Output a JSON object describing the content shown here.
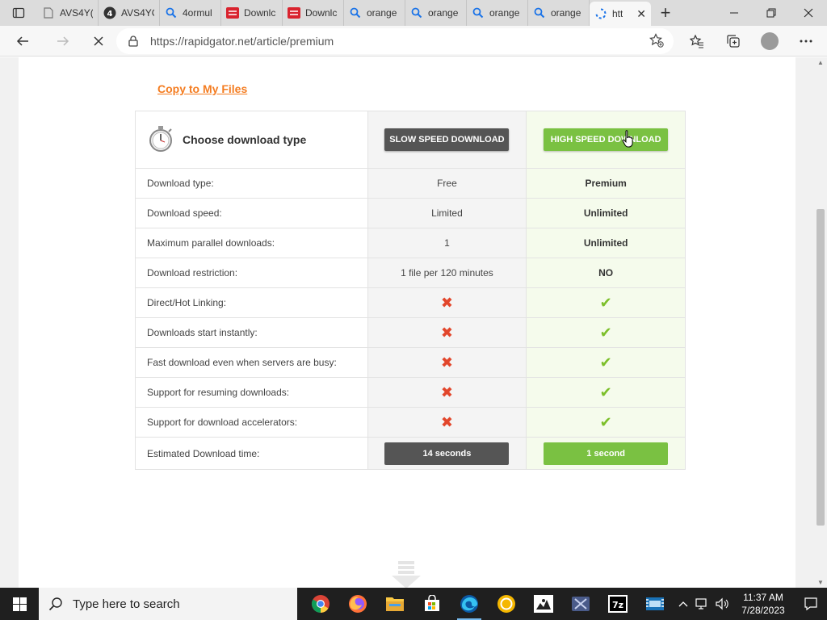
{
  "browser": {
    "tabs": [
      {
        "label": "AVS4Y(",
        "icon": "page-icon"
      },
      {
        "label": "AVS4YC",
        "icon": "circle-four-icon"
      },
      {
        "label": "4ormul",
        "icon": "search-icon"
      },
      {
        "label": "Downlc",
        "icon": "rapidgator-icon"
      },
      {
        "label": "Downlc",
        "icon": "rapidgator-icon"
      },
      {
        "label": "orange",
        "icon": "search-icon"
      },
      {
        "label": "orange",
        "icon": "search-icon"
      },
      {
        "label": "orange",
        "icon": "search-icon"
      },
      {
        "label": "orange",
        "icon": "search-icon"
      },
      {
        "label": "htt",
        "icon": "loading-icon",
        "active": true
      }
    ],
    "new_tab": "+",
    "url": "https://rapidgator.net/article/premium"
  },
  "page": {
    "copy_link": "Copy to My Files",
    "choose_label": "Choose download type",
    "slow_button": "SLOW SPEED DOWNLOAD",
    "fast_button": "HIGH SPEED DOWNLOAD",
    "rows": [
      {
        "label": "Download type:",
        "free": "Free",
        "premium": "Premium"
      },
      {
        "label": "Download speed:",
        "free": "Limited",
        "premium": "Unlimited"
      },
      {
        "label": "Maximum parallel downloads:",
        "free": "1",
        "premium": "Unlimited"
      },
      {
        "label": "Download restriction:",
        "free": "1 file per 120 minutes",
        "premium": "NO"
      },
      {
        "label": "Direct/Hot Linking:",
        "free": "x",
        "premium": "check"
      },
      {
        "label": "Downloads start instantly:",
        "free": "x",
        "premium": "check"
      },
      {
        "label": "Fast download even when servers are busy:",
        "free": "x",
        "premium": "check"
      },
      {
        "label": "Support for resuming downloads:",
        "free": "x",
        "premium": "check"
      },
      {
        "label": "Support for download accelerators:",
        "free": "x",
        "premium": "check"
      }
    ],
    "estimated": {
      "label": "Estimated Download time:",
      "free": "14 seconds",
      "premium": "1 second"
    }
  },
  "taskbar": {
    "search_placeholder": "Type here to search",
    "time": "11:37 AM",
    "date": "7/28/2023"
  },
  "colors": {
    "accent_orange": "#f47c20",
    "premium_green": "#7ac142",
    "slow_gray": "#555555"
  }
}
